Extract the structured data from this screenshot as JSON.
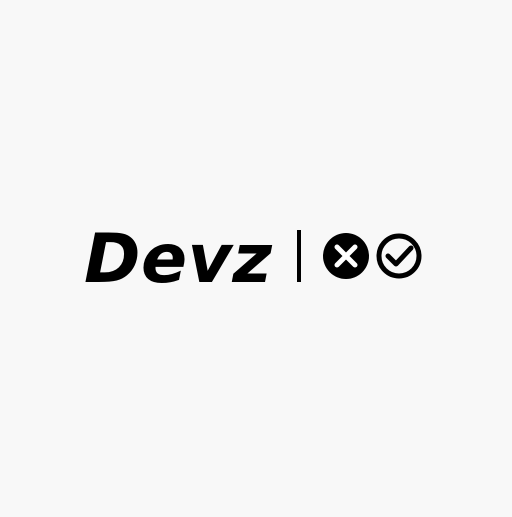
{
  "logo": {
    "wordmark": "Devz",
    "icons": [
      "x-circle-icon",
      "check-circle-icon"
    ],
    "colors": {
      "background": "#f8f8f8",
      "foreground": "#000000"
    }
  }
}
